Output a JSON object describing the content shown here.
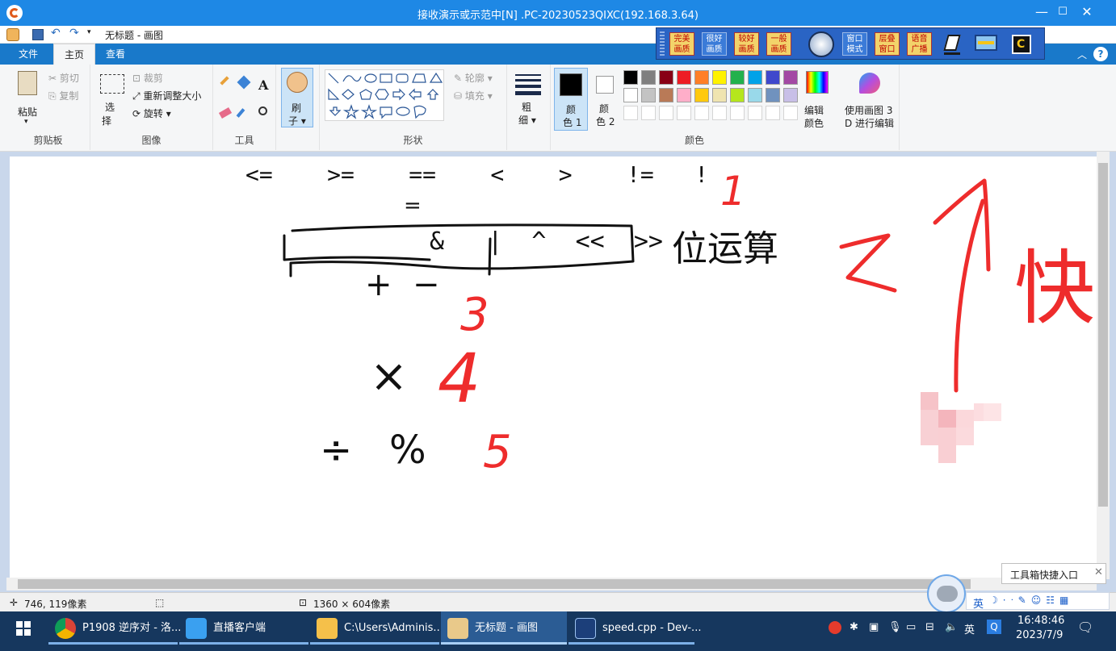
{
  "remote": {
    "title": "接收演示或示范中[N] .PC-20230523QIXC(192.168.3.64)",
    "min": "—",
    "max": "☐",
    "close": "✕"
  },
  "paint": {
    "doc_title": "无标题 - 画图",
    "tabs": [
      "文件",
      "主页",
      "查看"
    ],
    "clipboard": {
      "paste": "粘贴",
      "cut": "剪切",
      "copy": "复制",
      "label": "剪贴板"
    },
    "image": {
      "select": "选",
      "select2": "择",
      "crop": "裁剪",
      "resize": "重新调整大小",
      "rotate": "旋转",
      "label": "图像"
    },
    "tools": {
      "label": "工具",
      "text_glyph": "A"
    },
    "brush": {
      "line1": "刷",
      "line2": "子"
    },
    "shapes": {
      "outline": "轮廓",
      "fill": "填充",
      "label": "形状"
    },
    "size": {
      "line1": "粗",
      "line2": "细"
    },
    "color1": {
      "line1": "颜",
      "line2": "色 1"
    },
    "color2": {
      "line1": "颜",
      "line2": "色 2"
    },
    "edit_colors": {
      "line1": "编辑",
      "line2": "颜色"
    },
    "paint3d": {
      "line1": "使用画图 3",
      "line2": "D 进行编辑"
    },
    "colors_label": "颜色",
    "palette_row1": [
      "#000000",
      "#7f7f7f",
      "#880015",
      "#ed1c24",
      "#ff7f27",
      "#fff200",
      "#22b14c",
      "#00a2e8",
      "#3f48cc",
      "#a349a4"
    ],
    "palette_row2": [
      "#ffffff",
      "#c3c3c3",
      "#b97a57",
      "#ffaec9",
      "#ffc90e",
      "#efe4b0",
      "#b5e61d",
      "#99d9ea",
      "#7092be",
      "#c8bfe7"
    ]
  },
  "quality": {
    "b1a": "完美",
    "b1b": "画质",
    "b2a": "很好",
    "b2b": "画质",
    "b3a": "较好",
    "b3b": "画质",
    "b4a": "一般",
    "b4b": "画质",
    "b5a": "窗口",
    "b5b": "模式",
    "b6a": "层叠",
    "b6b": "窗口",
    "b7a": "语音",
    "b7b": "广播"
  },
  "canvas_text": {
    "row1": "<=    >=    ==    <    >    !=   !",
    "row1b": "=",
    "bitwise": "&   |  ^  <<  >>",
    "bitwise_label": "位运算",
    "arith1": "+  −",
    "arith2": "×",
    "arith3": "÷   %",
    "n1": "1",
    "n2": "2",
    "n3": "3",
    "n4": "4",
    "n5": "5",
    "kuai": "快"
  },
  "status": {
    "coords": "746, 119像素",
    "size": "1360 × 604像素"
  },
  "toolbox": {
    "label": "工具箱快捷入口"
  },
  "taskbar": {
    "items": [
      "P1908 逆序对 - 洛...",
      "直播客户端",
      "C:\\Users\\Adminis...",
      "无标题 - 画图",
      "speed.cpp - Dev-..."
    ],
    "ime": "英",
    "time": "16:48:46",
    "date": "2023/7/9",
    "tray_ime": "英"
  }
}
